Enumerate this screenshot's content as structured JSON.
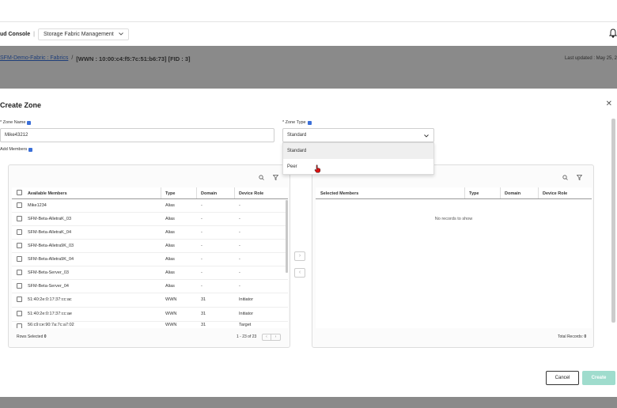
{
  "header": {
    "app_name": "ud Console",
    "separator": "|",
    "app_selector": "Storage Fabric Management"
  },
  "breadcrumb": {
    "fabrics_link": "SFM-Demo-Fabric : Fabrics",
    "slash": "/",
    "wwn_title": "[WWN : 10:00:c4:f5:7c:51:b6:73] [FID : 3]",
    "last_updated": "Last updated : May 25, 2"
  },
  "modal": {
    "title": "Create Zone",
    "zone_name_label": "* Zone Name",
    "zone_name_value": "Mike43212",
    "zone_type_label": "* Zone Type",
    "zone_type_value": "Standard",
    "add_members_label": "Add Members",
    "zone_type_options": [
      "Standard",
      "Peer"
    ]
  },
  "available": {
    "columns": [
      "Available Members",
      "Type",
      "Domain",
      "Device Role"
    ],
    "rows": [
      {
        "name": "Mike1234",
        "type": "Alias",
        "domain": "-",
        "role": "-"
      },
      {
        "name": "SFM-Beta-AlletraK_03",
        "type": "Alias",
        "domain": "-",
        "role": "-"
      },
      {
        "name": "SFM-Beta-AlletraK_04",
        "type": "Alias",
        "domain": "-",
        "role": "-"
      },
      {
        "name": "SFM-Beta-Alletra9K_03",
        "type": "Alias",
        "domain": "-",
        "role": "-"
      },
      {
        "name": "SFM-Beta-Alletra9K_04",
        "type": "Alias",
        "domain": "-",
        "role": "-"
      },
      {
        "name": "SFM-Beta-Server_03",
        "type": "Alias",
        "domain": "-",
        "role": "-"
      },
      {
        "name": "SFM-Beta-Server_04",
        "type": "Alias",
        "domain": "-",
        "role": "-"
      },
      {
        "name": "51:40:2e:0:17:37:cc:ac",
        "type": "WWN",
        "domain": "31",
        "role": "Initiator"
      },
      {
        "name": "51:40:2e:0:17:37:cc:ae",
        "type": "WWN",
        "domain": "31",
        "role": "Initiator"
      },
      {
        "name": "56:c9:ce:90:7a:7c:a7:02",
        "type": "WWN",
        "domain": "31",
        "role": "Target"
      }
    ],
    "rows_selected_label": "Rows Selected",
    "rows_selected_count": "0",
    "pagination": "1 - 23 of 23"
  },
  "selected": {
    "columns": [
      "Selected Members",
      "Type",
      "Domain",
      "Device Role"
    ],
    "empty_text": "No records to show",
    "total_label": "Total Records:",
    "total_count": "0"
  },
  "footer": {
    "cancel_label": "Cancel",
    "create_label": "Create"
  },
  "colors": {
    "accent": "#01a982",
    "create_disabled": "#9fdccd",
    "overlay": "#8a8a8a"
  }
}
